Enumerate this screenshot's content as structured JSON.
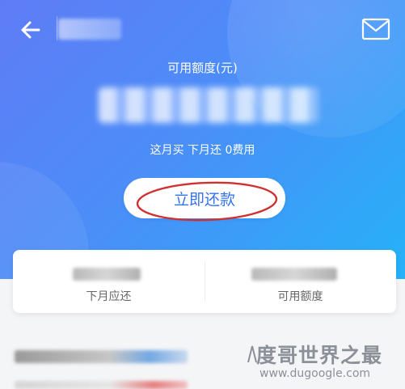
{
  "header": {
    "back_icon": "arrow-left-icon",
    "mail_icon": "mail-icon"
  },
  "hero": {
    "available_label": "可用额度(元)",
    "promo_text": "这月买 下月还 0费用",
    "repay_button": "立即还款",
    "annotation_color": "#d0302f"
  },
  "summary_card": {
    "left_label": "下月应还",
    "right_label": "可用额度"
  },
  "watermark": {
    "title": "度哥世界之最",
    "url": "www.dugoogle.com"
  },
  "colors": {
    "gradient_start": "#5f7cf6",
    "gradient_end": "#25b2f8",
    "button_text": "#3573ef"
  }
}
